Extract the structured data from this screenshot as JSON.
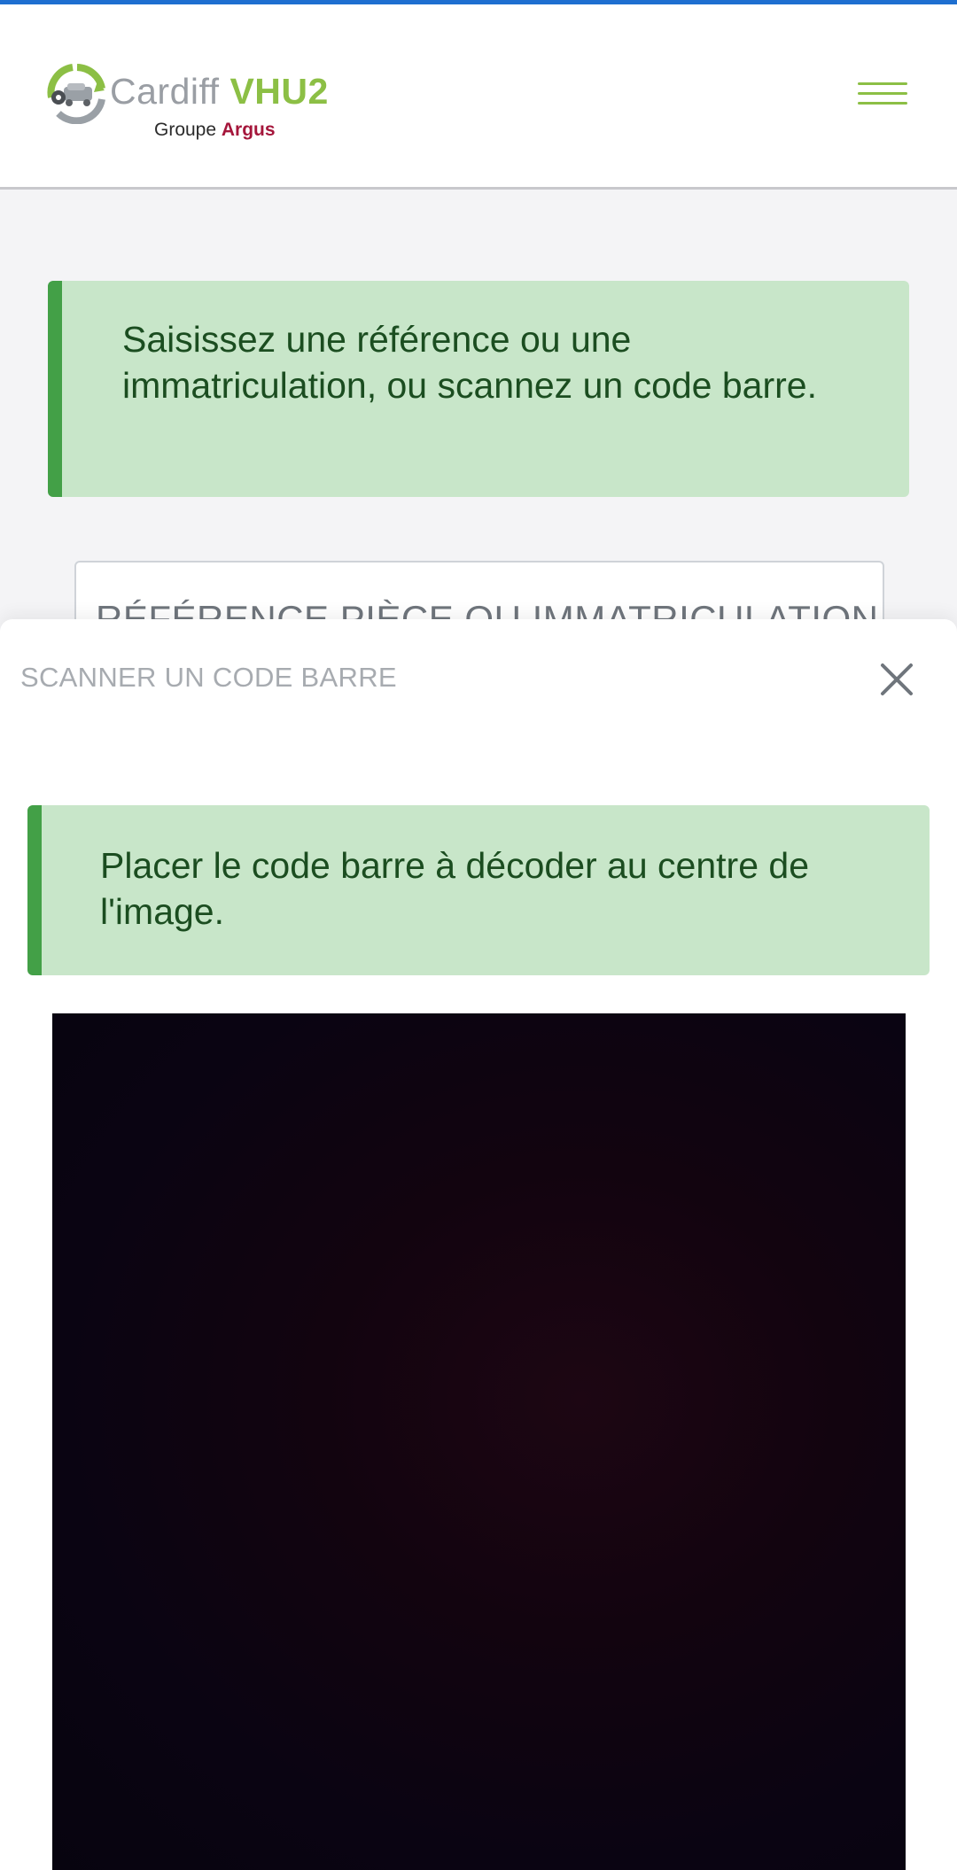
{
  "header": {
    "logo": {
      "brand": "Cardiff",
      "brand_bold": "VHU2",
      "group": "Groupe",
      "group_bold": "Argus"
    },
    "menu_icon": "hamburger-menu-icon",
    "colors": {
      "top_bar": "#1e6fd0",
      "brand_green": "#8cbf45",
      "brand_red": "#a5163b"
    }
  },
  "main": {
    "info_message": "Saisissez une référence ou une immatriculation, ou scannez un code barre.",
    "search": {
      "placeholder": "RÉFÉRENCE PIÈCE OU IMMATRICULATION",
      "value": ""
    }
  },
  "scanner": {
    "title": "SCANNER UN CODE BARRE",
    "close_icon": "close-icon",
    "instruction": "Placer le code barre à décoder au centre de l'image."
  },
  "colors": {
    "alert_bg": "#c8e6c9",
    "alert_border": "#43a047",
    "alert_text": "#1b4d20"
  }
}
